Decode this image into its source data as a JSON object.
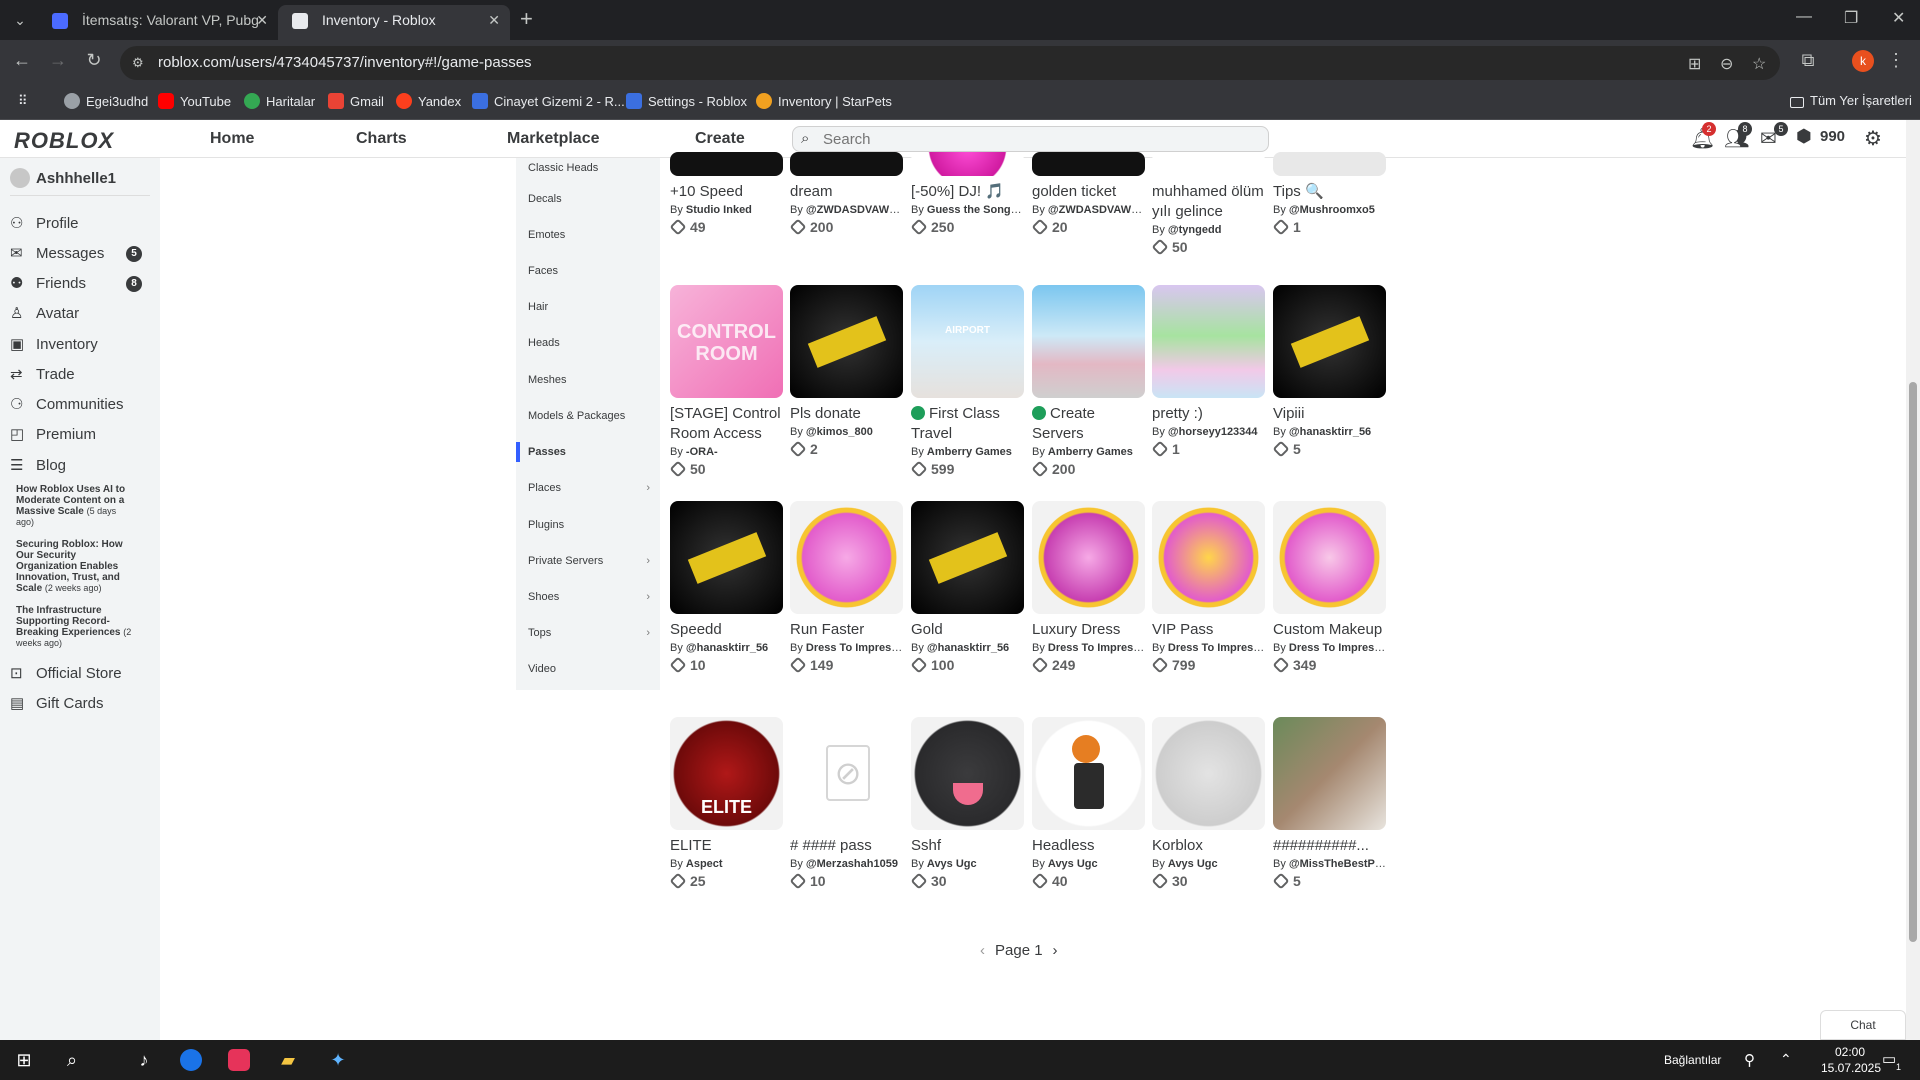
{
  "browser": {
    "tabs": [
      {
        "title": "İtemsatış: Valorant VP, Pubg Mo"
      },
      {
        "title": "Inventory - Roblox"
      }
    ],
    "url": "roblox.com/users/4734045737/inventory#!/game-passes",
    "profile_initial": "k",
    "bookmarks": [
      "Egei3udhd",
      "YouTube",
      "Haritalar",
      "Gmail",
      "Yandex",
      "Cinayet Gizemi 2 - R...",
      "Settings - Roblox",
      "Inventory | StarPets"
    ],
    "all_bookmarks": "Tüm Yer İşaretleri"
  },
  "header": {
    "logo": "ROBLOX",
    "nav": [
      "Home",
      "Charts",
      "Marketplace",
      "Create"
    ],
    "search_placeholder": "Search",
    "notifications_badge": "2",
    "friends_badge": "8",
    "messages_badge": "5",
    "robux": "990"
  },
  "sidebar": {
    "username": "Ashhhelle1",
    "items": [
      {
        "label": "Profile",
        "icon": "person-icon"
      },
      {
        "label": "Messages",
        "icon": "messages-icon",
        "badge": "5"
      },
      {
        "label": "Friends",
        "icon": "friends-icon",
        "badge": "8"
      },
      {
        "label": "Avatar",
        "icon": "avatar-icon"
      },
      {
        "label": "Inventory",
        "icon": "inventory-icon"
      },
      {
        "label": "Trade",
        "icon": "trade-icon"
      },
      {
        "label": "Communities",
        "icon": "communities-icon"
      },
      {
        "label": "Premium",
        "icon": "premium-icon"
      },
      {
        "label": "Blog",
        "icon": "blog-icon"
      }
    ],
    "blog_posts": [
      {
        "title": "How Roblox Uses AI to Moderate Content on a Massive Scale",
        "when": "(5 days ago)"
      },
      {
        "title": "Securing Roblox: How Our Security Organization Enables Innovation, Trust, and Scale",
        "when": "(2 weeks ago)"
      },
      {
        "title": "The Infrastructure Supporting Record-Breaking Experiences",
        "when": "(2 weeks ago)"
      }
    ],
    "official_store": "Official Store",
    "gift_cards": "Gift Cards"
  },
  "categories": [
    {
      "label": "Classic Heads"
    },
    {
      "label": "Decals"
    },
    {
      "label": "Emotes"
    },
    {
      "label": "Faces"
    },
    {
      "label": "Hair"
    },
    {
      "label": "Heads"
    },
    {
      "label": "Meshes"
    },
    {
      "label": "Models & Packages"
    },
    {
      "label": "Passes",
      "active": true
    },
    {
      "label": "Places",
      "chevron": true
    },
    {
      "label": "Plugins"
    },
    {
      "label": "Private Servers",
      "chevron": true
    },
    {
      "label": "Shoes",
      "chevron": true
    },
    {
      "label": "Tops",
      "chevron": true
    },
    {
      "label": "Video"
    }
  ],
  "items": [
    {
      "name": "+10 Speed",
      "by": "Studio Inked",
      "price": "49"
    },
    {
      "name": "dream",
      "by": "@ZWDASDVAWG...",
      "price": "200"
    },
    {
      "name": "[-50%] DJ! 🎵",
      "by": "Guess the Song o...",
      "price": "250"
    },
    {
      "name": "golden ticket",
      "by": "@ZWDASDVAWG...",
      "price": "20"
    },
    {
      "name": "muhhamed ölüm yılı gelince",
      "by": "@tyngedd",
      "price": "50"
    },
    {
      "name": "Tips 🔍",
      "by": "@Mushroomxo5",
      "price": "1"
    },
    {
      "name": "[STAGE] Control Room Access",
      "by": "-ORA-",
      "price": "50"
    },
    {
      "name": "Pls donate",
      "by": "@kimos_800",
      "price": "2"
    },
    {
      "name": "First Class Travel",
      "by": "Amberry Games",
      "price": "599"
    },
    {
      "name": "Create Servers",
      "by": "Amberry Games",
      "price": "200"
    },
    {
      "name": "pretty :)",
      "by": "@horseyy123344",
      "price": "1"
    },
    {
      "name": "Vipiii",
      "by": "@hanasktirr_56",
      "price": "5"
    },
    {
      "name": "Speedd",
      "by": "@hanasktirr_56",
      "price": "10"
    },
    {
      "name": "Run Faster",
      "by": "Dress To Impress ...",
      "price": "149"
    },
    {
      "name": "Gold",
      "by": "@hanasktirr_56",
      "price": "100"
    },
    {
      "name": "Luxury Dress",
      "by": "Dress To Impress ...",
      "price": "249"
    },
    {
      "name": "VIP Pass",
      "by": "Dress To Impress ...",
      "price": "799"
    },
    {
      "name": "Custom Makeup",
      "by": "Dress To Impress ...",
      "price": "349"
    },
    {
      "name": "ELITE",
      "by": "Aspect",
      "price": "25"
    },
    {
      "name": "# #### pass",
      "by": "@Merzashah1059",
      "price": "10"
    },
    {
      "name": "Sshf",
      "by": "Avys Ugc",
      "price": "30"
    },
    {
      "name": "Headless",
      "by": "Avys Ugc",
      "price": "40"
    },
    {
      "name": "Korblox",
      "by": "Avys Ugc",
      "price": "30"
    },
    {
      "name": "##########...",
      "by": "@MissTheBestPla...",
      "price": "5"
    }
  ],
  "by_prefix": "By",
  "elite_text": "ELITE",
  "airport_text": "AIRPORT",
  "control_text": "CONTROL ROOM",
  "pager": {
    "label": "Page 1"
  },
  "chat": "Chat",
  "taskbar": {
    "connections": "Bağlantılar",
    "time": "02:00",
    "date": "15.07.2025",
    "notif_count": "1"
  }
}
